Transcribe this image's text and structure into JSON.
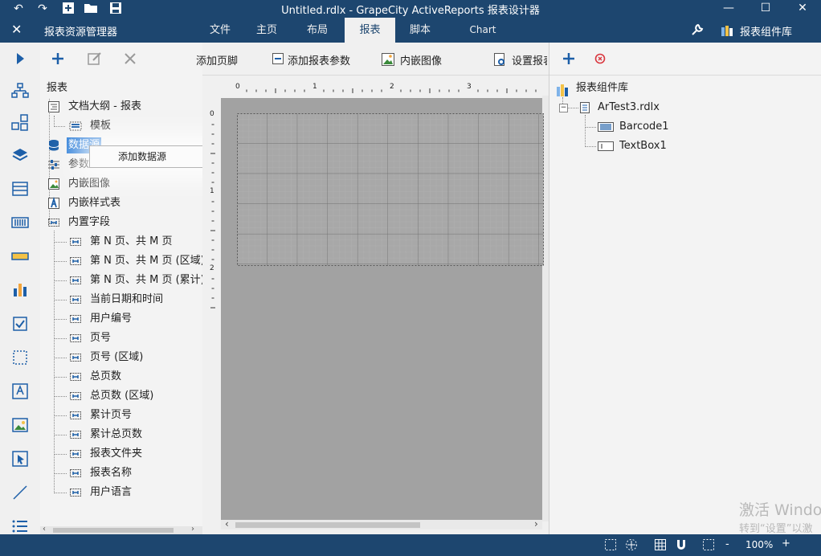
{
  "window": {
    "title": "Untitled.rdlx - GrapeCity ActiveReports 报表设计器"
  },
  "ribbon": {
    "explorer_title": "报表资源管理器",
    "tabs": [
      "文件",
      "主页",
      "布局",
      "报表",
      "脚本",
      "Chart"
    ],
    "active_tab": "报表",
    "commands": [
      "添加页脚",
      "添加报表参数",
      "内嵌图像",
      "设置报表"
    ],
    "library_title": "报表组件库"
  },
  "explorer": {
    "root": "报表",
    "items": [
      {
        "label": "文档大纲 - 报表"
      },
      {
        "label": "模板"
      },
      {
        "label": "数据源",
        "selected": true
      },
      {
        "label": "参数"
      },
      {
        "label": "内嵌图像"
      },
      {
        "label": "内嵌样式表"
      },
      {
        "label": "内置字段"
      }
    ],
    "builtin_fields": [
      "第 N 页、共 M 页",
      "第 N 页、共 M 页 (区域)",
      "第 N 页、共 M 页 (累计)",
      "当前日期和时间",
      "用户编号",
      "页号",
      "页号 (区域)",
      "总页数",
      "总页数 (区域)",
      "累计页号",
      "累计总页数",
      "报表文件夹",
      "报表名称",
      "用户语言"
    ]
  },
  "context_menu": {
    "items": [
      "添加数据源"
    ]
  },
  "ruler": {
    "h_ticks": [
      "0",
      "1",
      "2",
      "3"
    ],
    "v_ticks": [
      "0",
      "1",
      "2"
    ]
  },
  "library": {
    "root": "报表组件库",
    "file": "ArTest3.rdlx",
    "components": [
      "Barcode1",
      "TextBox1"
    ]
  },
  "status": {
    "zoom": "100%",
    "minus": "-",
    "plus": "+"
  },
  "watermark": {
    "line1": "激活 Windo",
    "line2": "转到“设置”以激"
  },
  "colors": {
    "chrome": "#1d466f",
    "accent": "#2e7bcf",
    "selection": "#2f7fd8"
  }
}
